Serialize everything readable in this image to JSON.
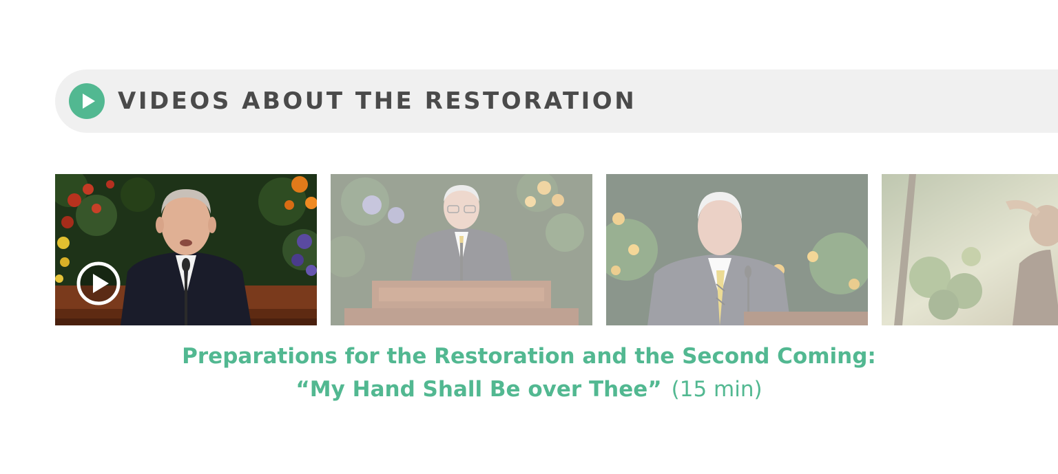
{
  "section": {
    "title": "VIDEOS ABOUT THE RESTORATION",
    "icon": "play-circle-icon",
    "accent_color": "#52b891"
  },
  "videos": [
    {
      "selected": true,
      "icon": "play-icon"
    },
    {
      "selected": false
    },
    {
      "selected": false
    },
    {
      "selected": false
    }
  ],
  "featured": {
    "title_line1": "Preparations for the Restoration and the Second Coming:",
    "title_line2": "“My Hand Shall Be over Thee”",
    "duration": "(15 min)"
  }
}
